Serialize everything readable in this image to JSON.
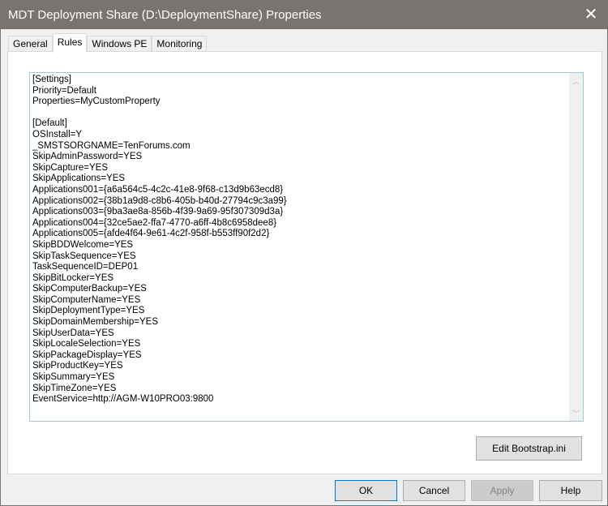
{
  "window": {
    "title": "MDT Deployment Share (D:\\DeploymentShare) Properties",
    "close_icon": "close-icon"
  },
  "tabs": [
    {
      "label": "General"
    },
    {
      "label": "Rules",
      "active": true
    },
    {
      "label": "Windows PE"
    },
    {
      "label": "Monitoring"
    }
  ],
  "rules_text": "[Settings]\nPriority=Default\nProperties=MyCustomProperty\n\n[Default]\nOSInstall=Y\n_SMSTSORGNAME=TenForums.com\nSkipAdminPassword=YES\nSkipCapture=YES\nSkipApplications=YES\nApplications001={a6a564c5-4c2c-41e8-9f68-c13d9b63ecd8}\nApplications002={38b1a9d8-c8b6-405b-b40d-27794c9c3a99}\nApplications003={9ba3ae8a-856b-4f39-9a69-95f307309d3a}\nApplications004={32ce5ae2-ffa7-4770-a6ff-4b8c6958dee8}\nApplications005={afde4f64-9e61-4c2f-958f-b553ff90f2d2}\nSkipBDDWelcome=YES\nSkipTaskSequence=YES\nTaskSequenceID=DEP01\nSkipBitLocker=YES\nSkipComputerBackup=YES\nSkipComputerName=YES\nSkipDeploymentType=YES\nSkipDomainMembership=YES\nSkipUserData=YES\nSkipLocaleSelection=YES\nSkipPackageDisplay=YES\nSkipProductKey=YES\nSkipSummary=YES\nSkipTimeZone=YES\nEventService=http://AGM-W10PRO03:9800",
  "edit_bootstrap": "Edit Bootstrap.ini",
  "buttons": {
    "ok": "OK",
    "cancel": "Cancel",
    "apply": "Apply",
    "help": "Help"
  }
}
